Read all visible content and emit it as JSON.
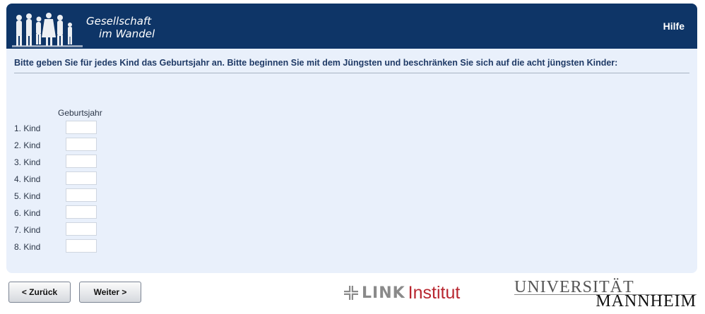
{
  "header": {
    "logo_line1": "Gesellschaft",
    "logo_line2": "im Wandel",
    "help_link": "Hilfe"
  },
  "question": {
    "text": "Bitte geben Sie für jedes Kind das Geburtsjahr an. Bitte beginnen Sie mit dem Jüngsten und beschränken Sie sich auf die acht jüngsten Kinder:",
    "column_header": "Geburtsjahr"
  },
  "children": [
    {
      "label": "1. Kind",
      "value": ""
    },
    {
      "label": "2. Kind",
      "value": ""
    },
    {
      "label": "3. Kind",
      "value": ""
    },
    {
      "label": "4. Kind",
      "value": ""
    },
    {
      "label": "5. Kind",
      "value": ""
    },
    {
      "label": "6. Kind",
      "value": ""
    },
    {
      "label": "7. Kind",
      "value": ""
    },
    {
      "label": "8. Kind",
      "value": ""
    }
  ],
  "navigation": {
    "back_label": "< Zurück",
    "next_label": "Weiter >"
  },
  "footer": {
    "link_logo_word": "LINK",
    "link_logo_institut": "Institut",
    "uni_line1": "UNIVERSITÄT",
    "uni_line2": "MANNHEIM"
  },
  "colors": {
    "header_bg": "#0e3567",
    "content_bg": "#e9f0fb",
    "question_text": "#1f3a66",
    "link_red": "#b8262f"
  }
}
